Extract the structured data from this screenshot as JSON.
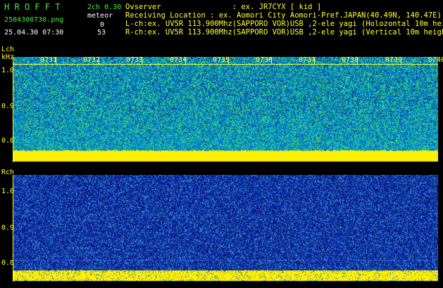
{
  "header": {
    "app_title": "H R O F F T",
    "filename": "2504300730.png",
    "datetime": "25.04.30 07:30",
    "channel_version": "2ch 0.30",
    "meteor_label": "meteor",
    "lch_count": "0",
    "rch_count": "53",
    "observer_line": "Ovserver                : ex. JR7CYX [ kid ]",
    "location_line": "Receiving Location : ex. Aomori City Aomori-Pref.JAPAN(40.49N, 140.47E)",
    "lch_info": "L-ch:ex. UV5R 113.900Mhz(SAPPORO VOR)USB ,2-ele yagi (Holozontal 10m height)",
    "rch_info": "R-ch:ex. UV5R 113.900Mhz(SAPPORO VOR)USB ,2-ele yagi (Vertical 10m height)"
  },
  "lch": {
    "label": "Lch",
    "unit": "kHz",
    "y_ticks": [
      "1.0",
      "0.9",
      "0.8"
    ],
    "time_ticks": [
      "0731",
      "0732",
      "0733",
      "0734",
      "0735",
      "0736",
      "0737",
      "0738",
      "0739",
      "0740"
    ]
  },
  "rch": {
    "label": "Rch",
    "y_ticks": [
      "1.0",
      "0.9",
      "0.8"
    ]
  },
  "colors": {
    "header_green": "#3cf03c",
    "header_white": "#ffffff",
    "axis_yellow": "#ffff33",
    "carrier_yellow": "#ffff00",
    "lch_noise": "cyan-green",
    "rch_noise": "deep-blue"
  }
}
